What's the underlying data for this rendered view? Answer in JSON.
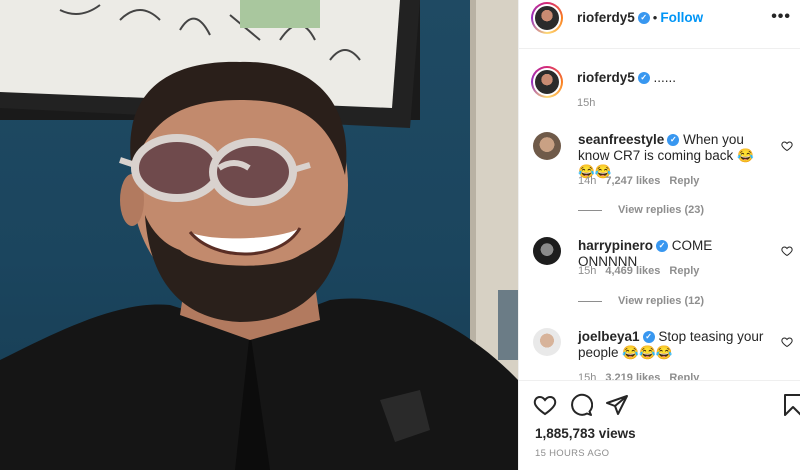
{
  "post": {
    "author": "rioferdy5",
    "follow_label": "Follow",
    "dot": "•",
    "more_label": "•••",
    "caption": "......",
    "caption_time": "15h",
    "views": "1,885,783 views",
    "time_ago": "15 HOURS AGO"
  },
  "comments": [
    {
      "user": "seanfreestyle",
      "text": "When you know CR7 is coming back 😂😂😂",
      "time": "14h",
      "likes": "7,247 likes",
      "reply": "Reply",
      "view_replies": "View replies (23)"
    },
    {
      "user": "harrypinero",
      "text": "COME ONNNNN",
      "time": "15h",
      "likes": "4,469 likes",
      "reply": "Reply",
      "view_replies": "View replies (12)"
    },
    {
      "user": "joelbeya1",
      "text": "Stop teasing your people 😂😂😂",
      "time": "15h",
      "likes": "3,219 likes",
      "reply": "Reply"
    }
  ],
  "icons": {
    "verified": "verified-badge-icon",
    "heart": "heart-icon",
    "comment": "comment-icon",
    "share": "share-icon",
    "save": "bookmark-icon",
    "more": "more-options-icon"
  },
  "colors": {
    "accent": "#0095f6",
    "verified": "#3897f0",
    "muted": "#8e8e8e",
    "text": "#262626"
  }
}
